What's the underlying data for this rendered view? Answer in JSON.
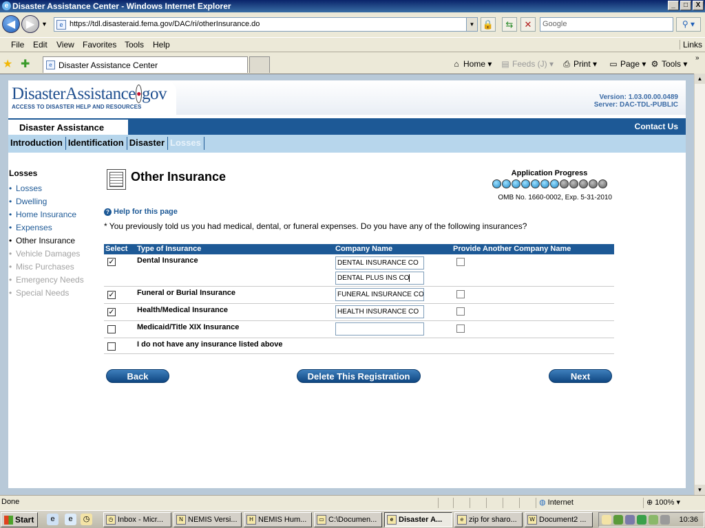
{
  "window": {
    "title": "Disaster Assistance Center - Windows Internet Explorer",
    "buttons": {
      "minimize": "_",
      "maximize": "□",
      "close": "X"
    }
  },
  "browser": {
    "url": "https://tdl.disasteraid.fema.gov/DAC/ri/otherInsurance.do",
    "search_placeholder": "Google",
    "menu": [
      "File",
      "Edit",
      "View",
      "Favorites",
      "Tools",
      "Help"
    ],
    "links_label": "Links",
    "tab_title": "Disaster Assistance Center",
    "commands": {
      "home": "Home",
      "feeds": "Feeds (J)",
      "print": "Print",
      "page": "Page",
      "tools": "Tools"
    }
  },
  "site": {
    "logo_main": "DisasterAssistance",
    "logo_dot": "•",
    "logo_gov": "gov",
    "logo_tagline": "ACCESS TO DISASTER HELP AND RESOURCES",
    "version": "Version: 1.03.00.00.0489",
    "server": "Server: DAC-TDL-PUBLIC",
    "section_title": "Disaster Assistance",
    "contact": "Contact Us",
    "steps": [
      {
        "label": "Introduction",
        "state": "done"
      },
      {
        "label": "Identification",
        "state": "done"
      },
      {
        "label": "Disaster",
        "state": "done"
      },
      {
        "label": "Losses",
        "state": "current"
      }
    ]
  },
  "leftnav": {
    "heading": "Losses",
    "items": [
      {
        "label": "Losses",
        "state": "link"
      },
      {
        "label": "Dwelling",
        "state": "link"
      },
      {
        "label": "Home Insurance",
        "state": "link"
      },
      {
        "label": "Expenses",
        "state": "link"
      },
      {
        "label": "Other Insurance",
        "state": "current"
      },
      {
        "label": "Vehicle Damages",
        "state": "disabled"
      },
      {
        "label": "Misc Purchases",
        "state": "disabled"
      },
      {
        "label": "Emergency Needs",
        "state": "disabled"
      },
      {
        "label": "Special Needs",
        "state": "disabled"
      }
    ]
  },
  "main": {
    "title": "Other Insurance",
    "progress_label": "Application Progress",
    "progress": {
      "completed": 7,
      "total": 12
    },
    "omb": "OMB No. 1660-0002, Exp. 5-31-2010",
    "help_link": "Help for this page",
    "question": "* You previously told us you had medical, dental, or funeral expenses. Do you have any of the following insurances?",
    "table": {
      "headers": [
        "Select",
        "Type of Insurance",
        "Company Name",
        "Provide Another Company Name"
      ],
      "rows": [
        {
          "selected": true,
          "type": "Dental Insurance",
          "companies": [
            "DENTAL INSURANCE CO",
            "DENTAL PLUS INS CO"
          ],
          "another": false
        },
        {
          "selected": true,
          "type": "Funeral or Burial Insurance",
          "companies": [
            "FUNERAL INSURANCE CO"
          ],
          "another": false
        },
        {
          "selected": true,
          "type": "Health/Medical Insurance",
          "companies": [
            "HEALTH INSURANCE CO"
          ],
          "another": false
        },
        {
          "selected": false,
          "type": "Medicaid/Title XIX Insurance",
          "companies": [
            ""
          ],
          "another": false
        },
        {
          "selected": false,
          "type": "I do not have any insurance listed above",
          "companies": [],
          "another": null
        }
      ]
    },
    "buttons": {
      "back": "Back",
      "delete": "Delete This Registration",
      "next": "Next"
    }
  },
  "statusbar": {
    "status": "Done",
    "zone": "Internet",
    "zoom": "100%"
  },
  "taskbar": {
    "start": "Start",
    "items": [
      {
        "label": "Inbox - Micr...",
        "active": false
      },
      {
        "label": "NEMIS Versi...",
        "active": false
      },
      {
        "label": "NEMIS Hum...",
        "active": false
      },
      {
        "label": "C:\\Documen...",
        "active": false
      },
      {
        "label": "Disaster A...",
        "active": true
      },
      {
        "label": "zip for sharo...",
        "active": false
      },
      {
        "label": "Document2 ...",
        "active": false
      }
    ],
    "clock": "10:36"
  },
  "colors": {
    "brand_blue": "#1d5996",
    "band_light": "#b7d6ec",
    "logo_red": "#c8102e"
  }
}
